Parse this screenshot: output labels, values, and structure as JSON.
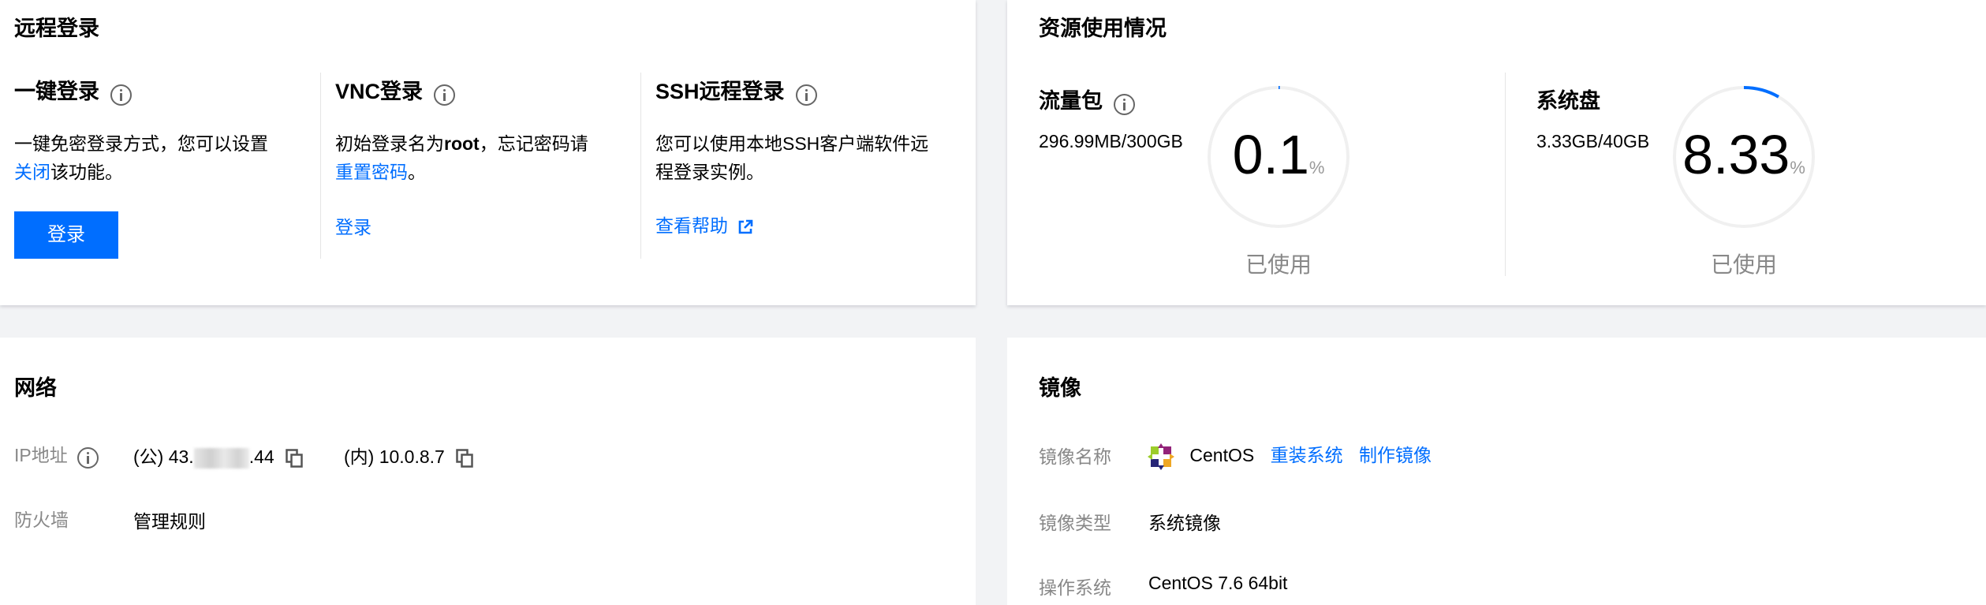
{
  "remote_login": {
    "title": "远程登录",
    "one_click": {
      "title": "一键登录",
      "desc_line1": "一键免密登录方式，您可以设置",
      "desc_link": "关闭",
      "desc_tail": "该功能。",
      "button": "登录"
    },
    "vnc": {
      "title": "VNC登录",
      "desc_pre": "初始登录名为",
      "desc_bold": "root",
      "desc_mid": "，忘记密码请",
      "desc_link": "重置密码",
      "desc_tail": "。",
      "link": "登录"
    },
    "ssh": {
      "title": "SSH远程登录",
      "desc_line1": "您可以使用本地SSH客户端软件远",
      "desc_line2": "程登录实例。",
      "link": "查看帮助"
    }
  },
  "resources": {
    "title": "资源使用情况",
    "traffic": {
      "title": "流量包",
      "usage": "296.99MB/300GB",
      "percent": "0.1",
      "percent_value": 0.1,
      "unit": "%",
      "used_label": "已使用"
    },
    "disk": {
      "title": "系统盘",
      "usage": "3.33GB/40GB",
      "percent": "8.33",
      "percent_value": 8.33,
      "unit": "%",
      "used_label": "已使用"
    },
    "colors": {
      "track": "#f0f0f0",
      "progress": "#006eff"
    }
  },
  "network": {
    "title": "网络",
    "ip_label": "IP地址",
    "public_prefix": "(公) 43.",
    "public_suffix": ".44",
    "private_ip": "(内) 10.0.8.7",
    "firewall_label": "防火墙",
    "firewall_link": "管理规则"
  },
  "image": {
    "title": "镜像",
    "name_label": "镜像名称",
    "name_value": "CentOS",
    "reinstall_link": "重装系统",
    "make_image_link": "制作镜像",
    "type_label": "镜像类型",
    "type_value": "系统镜像",
    "os_label": "操作系统",
    "os_value": "CentOS 7.6 64bit"
  }
}
